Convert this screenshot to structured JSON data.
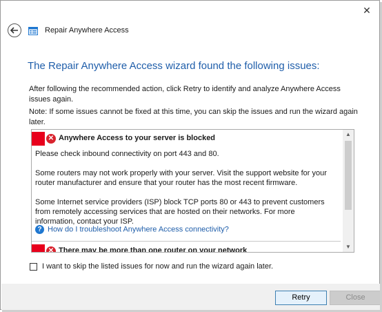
{
  "window": {
    "title": "Repair Anywhere Access",
    "close_glyph": "✕"
  },
  "icons": {
    "back": "back-arrow-icon",
    "app": "wizard-icon",
    "error": "error-icon",
    "help": "help-icon"
  },
  "main": {
    "heading": "The Repair Anywhere Access wizard found the following issues:",
    "para1": "After following the recommended action, click Retry to identify and analyze Anywhere Access issues again.",
    "para2": "Note: If some issues cannot be fixed at this time, you can skip the issues and run the wizard again later."
  },
  "issues": [
    {
      "title": "Anywhere Access to your server is blocked",
      "body": [
        "Please check inbound connectivity on port 443 and 80.",
        "Some routers may not work properly with your server. Visit the support website for your router manufacturer and ensure that your router has the most recent firmware.",
        "Some Internet service providers (ISP) block TCP ports 80 or 443 to prevent customers from remotely accessing services that are hosted on their networks. For more information, contact your ISP."
      ],
      "help_link": "How do I troubleshoot Anywhere Access connectivity?"
    },
    {
      "title": "There may be more than one router on your network"
    }
  ],
  "skip_checkbox": {
    "label": "I want to skip the listed issues for now and run the wizard again later.",
    "checked": false
  },
  "buttons": {
    "retry": "Retry",
    "close": "Close"
  },
  "colors": {
    "accent": "#1f5eaa",
    "error_red": "#e8001c",
    "footer_bg": "#f0f0f0"
  }
}
